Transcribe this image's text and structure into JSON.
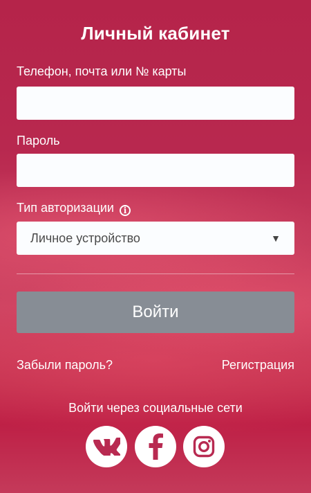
{
  "page": {
    "title": "Личный кабинет"
  },
  "login_field": {
    "label": "Телефон, почта или № карты",
    "value": "",
    "placeholder": ""
  },
  "password_field": {
    "label": "Пароль",
    "value": "",
    "placeholder": ""
  },
  "auth_type": {
    "label": "Тип авторизации",
    "info_icon": "info-icon",
    "selected": "Личное устройство"
  },
  "submit": {
    "label": "Войти"
  },
  "links": {
    "forgot_password": "Забыли пароль?",
    "register": "Регистрация"
  },
  "social": {
    "title": "Войти через социальные сети",
    "networks": [
      "vk-icon",
      "facebook-icon",
      "instagram-icon"
    ]
  },
  "colors": {
    "brand_accent": "#b82a51",
    "button_disabled": "#878d95",
    "input_background": "#fbfdff",
    "social_icon": "#b82a51"
  }
}
